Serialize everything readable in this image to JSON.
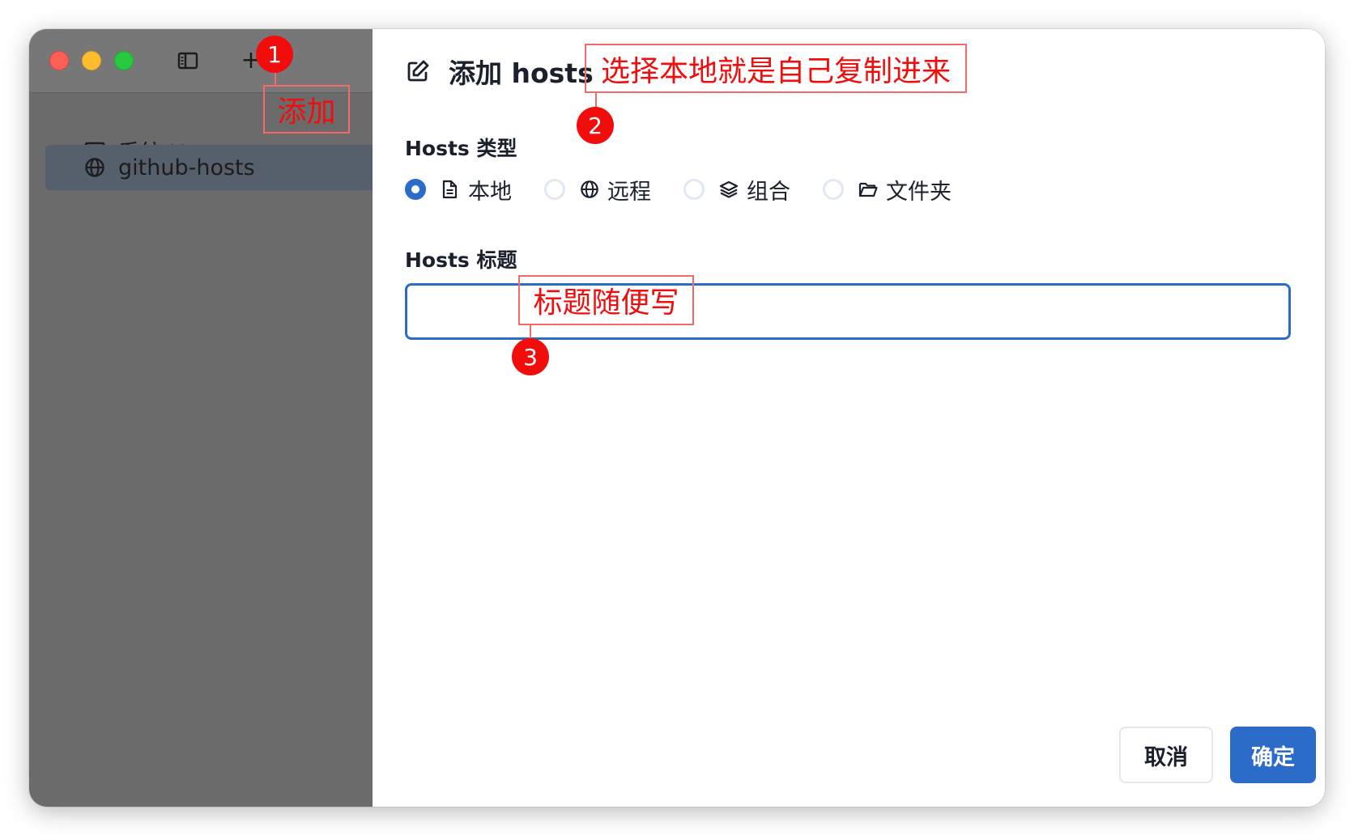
{
  "sidebar": {
    "items": [
      {
        "label": "系统 Hosts",
        "icon": "monitor-icon",
        "active": false
      },
      {
        "label": "github-hosts",
        "icon": "globe-icon",
        "active": true
      }
    ],
    "add_label": "+"
  },
  "dialog": {
    "title": "添加 hosts",
    "type_label": "Hosts 类型",
    "types": [
      {
        "label": "本地",
        "icon": "file-icon",
        "checked": true
      },
      {
        "label": "远程",
        "icon": "globe-icon",
        "checked": false
      },
      {
        "label": "组合",
        "icon": "layers-icon",
        "checked": false
      },
      {
        "label": "文件夹",
        "icon": "folder-icon",
        "checked": false
      }
    ],
    "title_label": "Hosts 标题",
    "title_value": "",
    "cancel_label": "取消",
    "confirm_label": "确定"
  },
  "annotations": [
    {
      "badge": "1",
      "note": "添加"
    },
    {
      "badge": "2",
      "note": "选择本地就是自己复制进来"
    },
    {
      "badge": "3",
      "note": "标题随便写"
    }
  ],
  "colors": {
    "accent": "#2b6cc8",
    "sidebar_bg": "#6b6b6b",
    "active_item_bg": "#56606c",
    "annotation_red": "#f20d0d"
  }
}
